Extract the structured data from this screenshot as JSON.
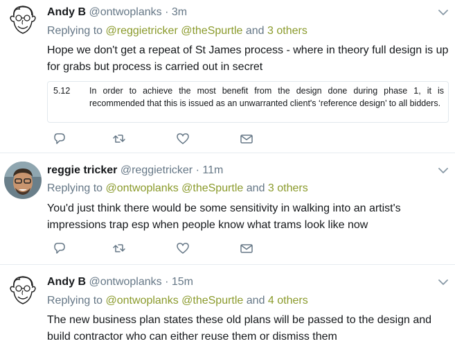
{
  "tweets": [
    {
      "name": "Andy B",
      "handle": "@ontwoplanks",
      "dot": "·",
      "time": "3m",
      "reply_prefix": "Replying to",
      "reply_handles": "@reggietricker @theSpurtle",
      "reply_and": "and",
      "reply_others": "3 others",
      "text": "Hope we don't get a repeat of St James process - where in theory full design is up for grabs but process is carried out in secret",
      "quote": {
        "number": "5.12",
        "text": "In order to achieve the most benefit from the design done during phase 1, it is recommended that this is issued as an unwarranted client's ‘reference design’ to all bidders."
      },
      "avatar": "cartoon-face-avatar"
    },
    {
      "name": "reggie tricker",
      "handle": "@reggietricker",
      "dot": "·",
      "time": "11m",
      "reply_prefix": "Replying to",
      "reply_handles": "@ontwoplanks @theSpurtle",
      "reply_and": "and",
      "reply_others": "3 others",
      "text": "You'd just think there would be some sensitivity in walking into an artist's impressions trap esp when people know what trams look like now",
      "avatar": "photo-avatar"
    },
    {
      "name": "Andy B",
      "handle": "@ontwoplanks",
      "dot": "·",
      "time": "15m",
      "reply_prefix": "Replying to",
      "reply_handles": "@ontwoplanks @theSpurtle",
      "reply_and": "and",
      "reply_others": "4 others",
      "text": "The new business plan states these old plans will be passed to the design and build contractor who can either reuse them or dismiss them",
      "avatar": "cartoon-face-avatar"
    }
  ],
  "icons": [
    "reply-icon",
    "retweet-icon",
    "like-icon",
    "direct-message-icon",
    "chevron-down-icon"
  ],
  "colors": {
    "link": "#8a9a2b",
    "muted": "#657786",
    "icon": "#657786",
    "divider": "#e6ecf0"
  }
}
